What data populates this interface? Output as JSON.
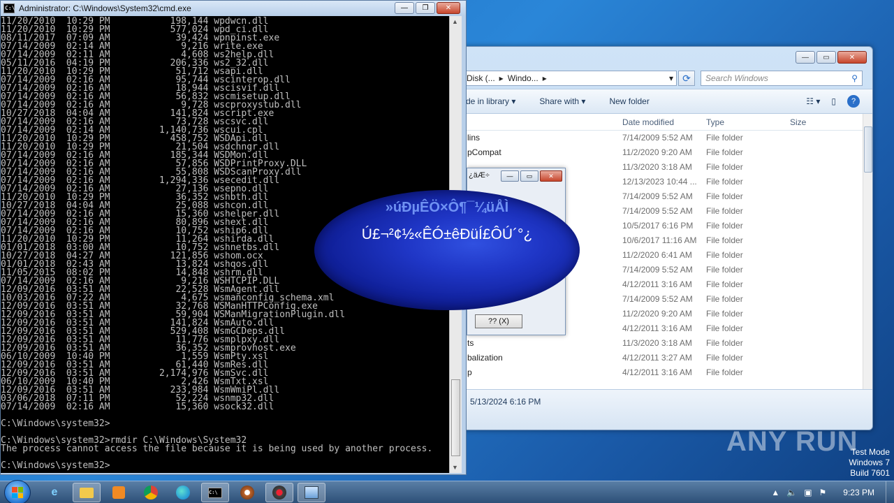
{
  "cmd": {
    "title": "Administrator: C:\\Windows\\System32\\cmd.exe",
    "lines": [
      "11/20/2010  10:29 PM           198,144 wpdwcn.dll",
      "11/20/2010  10:29 PM           577,024 wpd_ci.dll",
      "08/11/2017  07:09 AM            39,424 wpnpinst.exe",
      "07/14/2009  02:14 AM             9,216 write.exe",
      "07/14/2009  02:11 AM             4,608 ws2help.dll",
      "05/11/2016  04:19 PM           206,336 ws2_32.dll",
      "11/20/2010  10:29 PM            51,712 wsapi.dll",
      "07/14/2009  02:16 AM            95,744 wscinterop.dll",
      "07/14/2009  02:16 AM            18,944 wscisvif.dll",
      "07/14/2009  02:16 AM            56,832 wscmisetup.dll",
      "07/14/2009  02:16 AM             9,728 wscproxystub.dll",
      "10/27/2018  04:04 AM           141,824 wscript.exe",
      "07/14/2009  02:16 AM            73,728 wscsvc.dll",
      "07/14/2009  02:14 AM         1,140,736 wscui.cpl",
      "11/20/2010  10:29 PM           458,752 WSDApi.dll",
      "11/20/2010  10:29 PM            21,504 wsdchngr.dll",
      "07/14/2009  02:16 AM           185,344 WSDMon.dll",
      "07/14/2009  02:16 AM            57,856 WSDPrintProxy.DLL",
      "07/14/2009  02:16 AM            55,808 WSDScanProxy.dll",
      "07/14/2009  02:16 AM         1,294,336 wsecedit.dll",
      "07/14/2009  02:16 AM            27,136 wsepno.dll",
      "11/20/2010  10:29 PM            36,352 wshbth.dll",
      "10/27/2018  04:04 AM            25,088 wshcon.dll",
      "07/14/2009  02:16 AM            15,360 wshelper.dll",
      "07/14/2009  02:16 AM            80,896 wshext.dll",
      "07/14/2009  02:16 AM            10,752 wship6.dll",
      "11/20/2010  10:29 PM            11,264 wshirda.dll",
      "01/01/2018  03:00 AM            10,752 wshnetbs.dll",
      "10/27/2018  04:27 AM           121,856 wshom.ocx",
      "01/01/2018  02:43 AM            13,824 wshqos.dll",
      "11/05/2015  08:02 PM            14,848 wshrm.dll",
      "07/14/2009  02:16 AM             9,216 WSHTCPIP.DLL",
      "12/09/2016  03:51 AM            22,528 WsmAgent.dll",
      "10/03/2016  07:22 AM             4,675 wsmanconfig_schema.xml",
      "12/09/2016  03:51 AM            32,768 WSManHTTPConfig.exe",
      "12/09/2016  03:51 AM            59,904 WSManMigrationPlugin.dll",
      "12/09/2016  03:51 AM           141,824 WsmAuto.dll",
      "12/09/2016  03:51 AM           529,408 WsmGCDeps.dll",
      "12/09/2016  03:51 AM            11,776 wsmplpxy.dll",
      "12/09/2016  03:51 AM            36,352 wsmprovhost.exe",
      "06/10/2009  10:40 PM             1,559 WsmPty.xsl",
      "12/09/2016  03:51 AM            61,440 WsmRes.dll",
      "12/09/2016  03:51 AM         2,174,976 WsmSvc.dll",
      "06/10/2009  10:40 PM             2,426 WsmTxt.xsl",
      "12/09/2016  03:51 AM           233,984 WsmWmiPl.dll",
      "03/06/2018  07:11 PM            52,224 wsnmp32.dll",
      "07/14/2009  02:16 AM            15,360 wsock32.dll",
      "",
      "C:\\Windows\\system32>",
      "",
      "C:\\Windows\\system32>rmdir C:\\Windows\\System32",
      "The process cannot access the file because it is being used by another process.",
      "",
      "C:\\Windows\\system32>"
    ]
  },
  "explorer": {
    "address_parts": [
      "Disk (...",
      "Windo..."
    ],
    "search_placeholder": "Search Windows",
    "toolbar": {
      "include": "de in library",
      "share": "Share with",
      "new_folder": "New folder"
    },
    "columns": {
      "date": "Date modified",
      "type": "Type",
      "size": "Size"
    },
    "rows": [
      {
        "name": "lins",
        "date": "7/14/2009 5:52 AM",
        "type": "File folder"
      },
      {
        "name": "pCompat",
        "date": "11/2/2020 9:20 AM",
        "type": "File folder"
      },
      {
        "name": "",
        "date": "11/3/2020 3:18 AM",
        "type": "File folder"
      },
      {
        "name": "",
        "date": "12/13/2023 10:44 ...",
        "type": "File folder"
      },
      {
        "name": "",
        "date": "7/14/2009 5:52 AM",
        "type": "File folder"
      },
      {
        "name": "",
        "date": "7/14/2009 5:52 AM",
        "type": "File folder"
      },
      {
        "name": "",
        "date": "10/5/2017 6:16 PM",
        "type": "File folder"
      },
      {
        "name": "",
        "date": "10/6/2017 11:16 AM",
        "type": "File folder"
      },
      {
        "name": "",
        "date": "11/2/2020 6:41 AM",
        "type": "File folder"
      },
      {
        "name": "",
        "date": "7/14/2009 5:52 AM",
        "type": "File folder"
      },
      {
        "name": "",
        "date": "4/12/2011 3:16 AM",
        "type": "File folder"
      },
      {
        "name": "",
        "date": "7/14/2009 5:52 AM",
        "type": "File folder"
      },
      {
        "name": "",
        "date": "11/2/2020 9:20 AM",
        "type": "File folder"
      },
      {
        "name": "",
        "date": "4/12/2011 3:16 AM",
        "type": "File folder"
      },
      {
        "name": "ts",
        "date": "11/3/2020 3:18 AM",
        "type": "File folder"
      },
      {
        "name": "balization",
        "date": "4/12/2011 3:27 AM",
        "type": "File folder"
      },
      {
        "name": "p",
        "date": "4/12/2011 3:16 AM",
        "type": "File folder"
      }
    ],
    "details_date": "5/13/2024 6:16 PM"
  },
  "dialog": {
    "title": "¿äÆ÷",
    "button": "?? (X)"
  },
  "blob": {
    "line1": "»úÐµÊÖ×Ô¶¯¼üÅÌ",
    "line2": "Ú£¬²¢½«ÊÓ±êÐüÍ£ÔÚ´°¿"
  },
  "watermark": {
    "text": "ANY RUN"
  },
  "testmode": {
    "l1": "Test Mode",
    "l2": "Windows 7",
    "l3": "Build 7601"
  },
  "taskbar": {
    "clock": "9:23 PM"
  }
}
